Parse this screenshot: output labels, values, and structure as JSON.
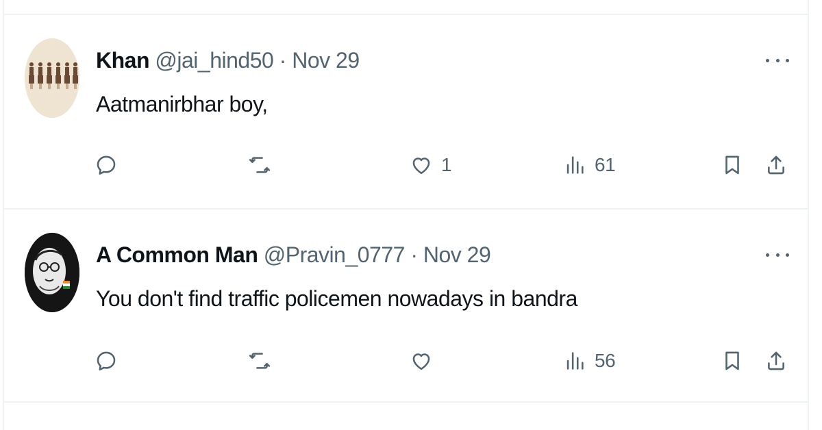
{
  "tweets": [
    {
      "name": "Khan",
      "handle": "@jai_hind50",
      "dot": "·",
      "date": "Nov 29",
      "text": "Aatmanirbhar boy,",
      "reply_count": "",
      "retweet_count": "",
      "like_count": "1",
      "view_count": "61",
      "avatar_style": "sepia-figures"
    },
    {
      "name": "A Common Man",
      "handle": "@Pravin_0777",
      "dot": "·",
      "date": "Nov 29",
      "text": "You don't find traffic policemen nowadays in bandra",
      "reply_count": "",
      "retweet_count": "",
      "like_count": "",
      "view_count": "56",
      "avatar_style": "sketch-portrait"
    }
  ],
  "icons": {
    "reply": "reply-icon",
    "retweet": "retweet-icon",
    "like": "heart-icon",
    "views": "views-chart-icon",
    "bookmark": "bookmark-icon",
    "share": "share-icon",
    "more": "more-dots-icon"
  },
  "colors": {
    "text_primary": "#0f1419",
    "text_secondary": "#536471",
    "divider": "#eff3f4",
    "background": "#ffffff"
  }
}
